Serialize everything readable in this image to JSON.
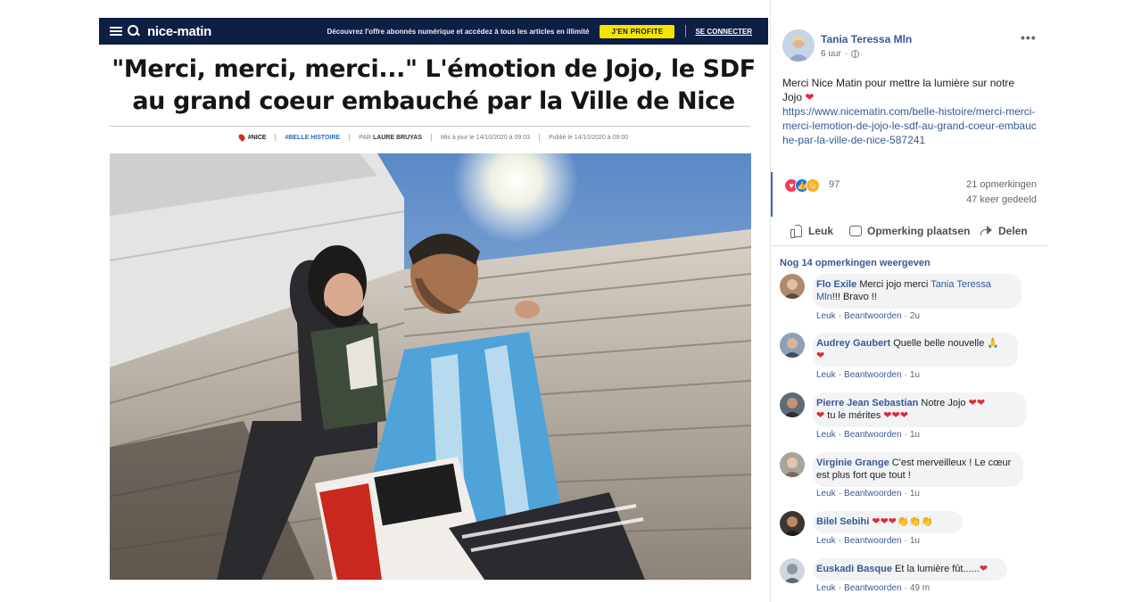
{
  "article": {
    "logo": "nice-matin",
    "offer_text": "Découvrez l'offre abonnés numérique et accédez à tous les articles en illimité",
    "cta_label": "J'EN PROFITE",
    "login_label": "SE CONNECTER",
    "headline": "\"Merci, merci, merci...\" L'émotion de Jojo, le SDF au grand coeur embauché par la Ville de Nice",
    "tag_city": "#NICE",
    "tag_topic": "#BELLE HISTOIRE",
    "byline_prefix": "PAR",
    "byline_author": "LAURE BRUYAS",
    "updated": "Mis à jour le 14/10/2020 à 09:03",
    "published": "Publié le 14/10/2020 à 09:00"
  },
  "post": {
    "author": "Tania Teressa Mln",
    "time": "6 uur",
    "more_icon": "ellipsis-icon",
    "text": "Merci Nice Matin pour mettre la lumière sur notre Jojo",
    "text_emoji": "❤",
    "link": "https://www.nicematin.com/belle-histoire/merci-merci-merci-lemotion-de-jojo-le-sdf-au-grand-coeur-embauche-par-la-ville-de-nice-587241",
    "reaction_count": "97",
    "comments_count": "21 opmerkingen",
    "shares_count": "47 keer gedeeld",
    "actions": {
      "like": "Leuk",
      "comment": "Opmerking plaatsen",
      "share": "Delen"
    },
    "more_comments": "Nog 14 opmerkingen weergeven"
  },
  "comments": [
    {
      "name": "Flo Exile",
      "text_a": "Merci jojo merci",
      "mention": "Tania Teressa Mln",
      "text_b": "!!! Bravo !!",
      "like": "Leuk",
      "reply": "Beantwoorden",
      "age": "2u"
    },
    {
      "name": "Audrey Gaubert",
      "text": "Quelle belle nouvelle",
      "emoji": "🙏 ❤",
      "like": "Leuk",
      "reply": "Beantwoorden",
      "age": "1u"
    },
    {
      "name": "Pierre Jean Sebastian",
      "text": "Notre Jojo",
      "emoji_a": "❤❤",
      "emoji_b": "❤",
      "text_b": "tu le mérites",
      "emoji_c": "❤❤❤",
      "like": "Leuk",
      "reply": "Beantwoorden",
      "age": "1u"
    },
    {
      "name": "Virginie Grange",
      "text": "C'est merveilleux ! Le cœur est plus fort que tout !",
      "like": "Leuk",
      "reply": "Beantwoorden",
      "age": "1u"
    },
    {
      "name": "Bilel Sebihi",
      "emoji_hearts": "❤❤❤",
      "emoji_claps": "👏👏👏",
      "like": "Leuk",
      "reply": "Beantwoorden",
      "age": "1u"
    },
    {
      "name": "Euskadi Basque",
      "text": "Et la lumière fût......",
      "emoji": "❤",
      "like": "Leuk",
      "reply": "Beantwoorden",
      "age": "49 m"
    }
  ],
  "colors": {
    "nm_navy": "#0e1f44",
    "nm_yellow": "#f7e300",
    "fb_blue": "#385898",
    "heart_red": "#e0293b"
  }
}
